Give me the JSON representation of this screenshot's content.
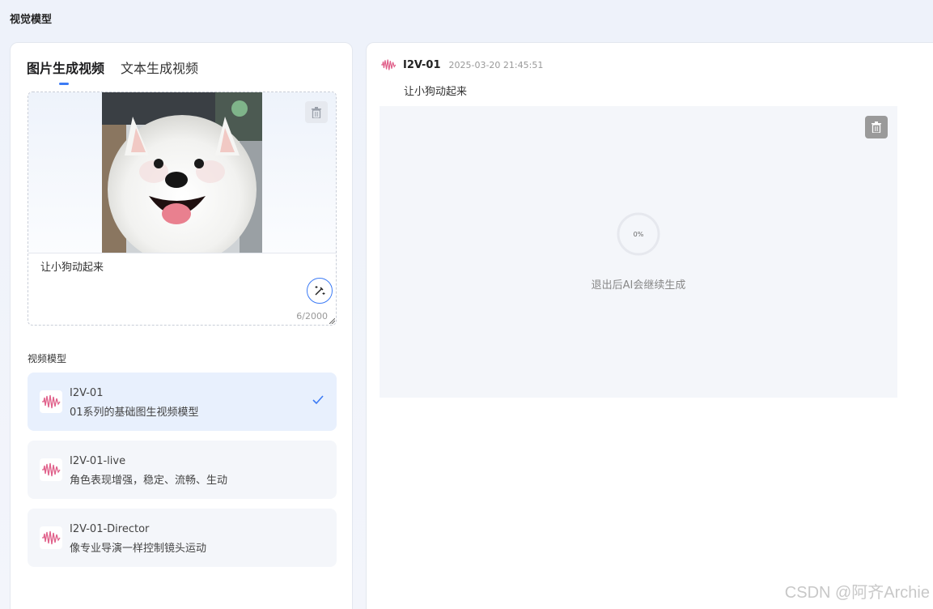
{
  "page": {
    "title": "视觉模型"
  },
  "tabs": [
    {
      "label": "图片生成视频",
      "active": true
    },
    {
      "label": "文本生成视频",
      "active": false
    }
  ],
  "upload": {
    "image_alt": "samoyed-dog-photo",
    "prompt": "让小狗动起来",
    "char_count": "6/2000"
  },
  "models": {
    "section_label": "视频模型",
    "items": [
      {
        "name": "I2V-01",
        "description": "01系列的基础图生视频模型",
        "selected": true
      },
      {
        "name": "I2V-01-live",
        "description": "角色表现增强，稳定、流畅、生动",
        "selected": false
      },
      {
        "name": "I2V-01-Director",
        "description": "像专业导演一样控制镜头运动",
        "selected": false
      }
    ]
  },
  "result": {
    "model": "I2V-01",
    "timestamp": "2025-03-20 21:45:51",
    "prompt": "让小狗动起来",
    "progress_label": "0%",
    "progress_value": 0,
    "status": "退出后AI会继续生成"
  },
  "watermark": "CSDN @阿齐Archie",
  "colors": {
    "accent": "#3c7bf5",
    "wave_icon": "#e0608a",
    "selected_card": "#e8f0fd"
  }
}
